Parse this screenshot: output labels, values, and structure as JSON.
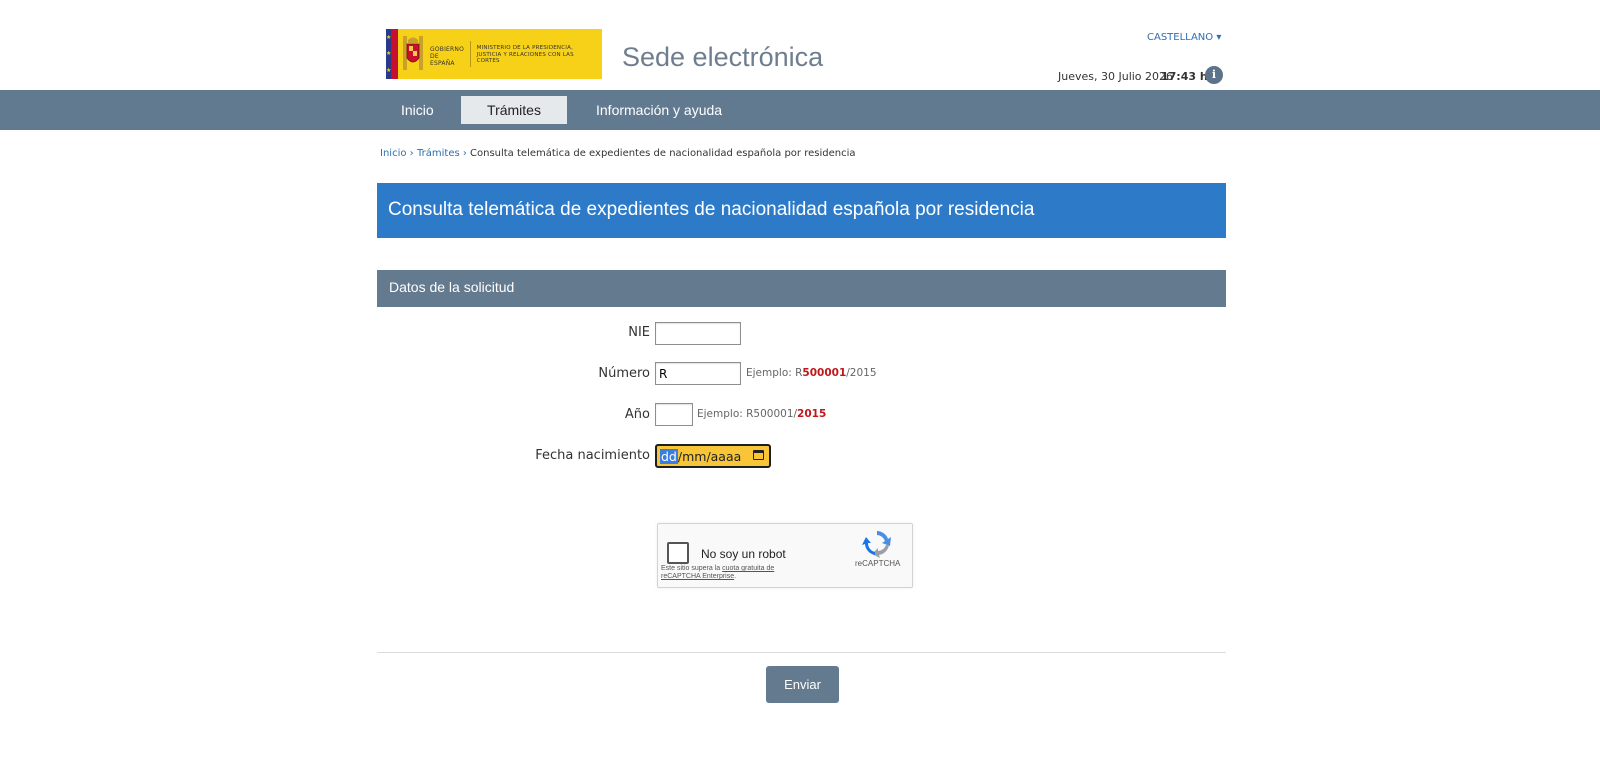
{
  "header": {
    "logo": {
      "gobierno": "GOBIERNO DE ESPAÑA",
      "ministerio": "MINISTERIO DE LA PRESIDENCIA, JUSTICIA Y RELACIONES CON LAS CORTES"
    },
    "site_title": "Sede electrónica",
    "language": "CASTELLANO ▾",
    "date": "Jueves, 30 Julio 2026",
    "time": "17:43 h.",
    "info_icon": "i"
  },
  "nav": {
    "items": [
      {
        "label": "Inicio"
      },
      {
        "label": "Trámites",
        "active": true
      },
      {
        "label": "Información y ayuda"
      }
    ]
  },
  "breadcrumb": {
    "items": [
      "Inicio ›",
      "Trámites ›"
    ],
    "current": "Consulta telemática de expedientes de nacionalidad española por residencia"
  },
  "page_title": "Consulta telemática de expedientes de nacionalidad española por residencia",
  "section_title": "Datos de la solicitud",
  "form": {
    "nie": {
      "label": "NIE",
      "value": ""
    },
    "numero": {
      "label": "Número",
      "value": "R",
      "hint_prefix": "Ejemplo: R",
      "hint_highlight": "500001",
      "hint_suffix": "/2015"
    },
    "anio": {
      "label": "Año",
      "value": "",
      "hint_prefix": "Ejemplo: R500001/",
      "hint_highlight": "2015"
    },
    "fecha": {
      "label": "Fecha nacimiento",
      "seg_dd": "dd",
      "seg_rest": "/mm/aaaa"
    }
  },
  "captcha": {
    "label": "No soy un robot",
    "brand": "reCAPTCHA",
    "notice_prefix": "Este sitio supera la ",
    "notice_link": "cuota gratuita de reCAPTCHA Enterprise",
    "notice_suffix": "."
  },
  "submit": {
    "label": "Enviar"
  },
  "colors": {
    "nav": "#627a90",
    "title_bar": "#2d7ac9",
    "accent_red": "#c0161c",
    "date_focus": "#f7c537"
  }
}
